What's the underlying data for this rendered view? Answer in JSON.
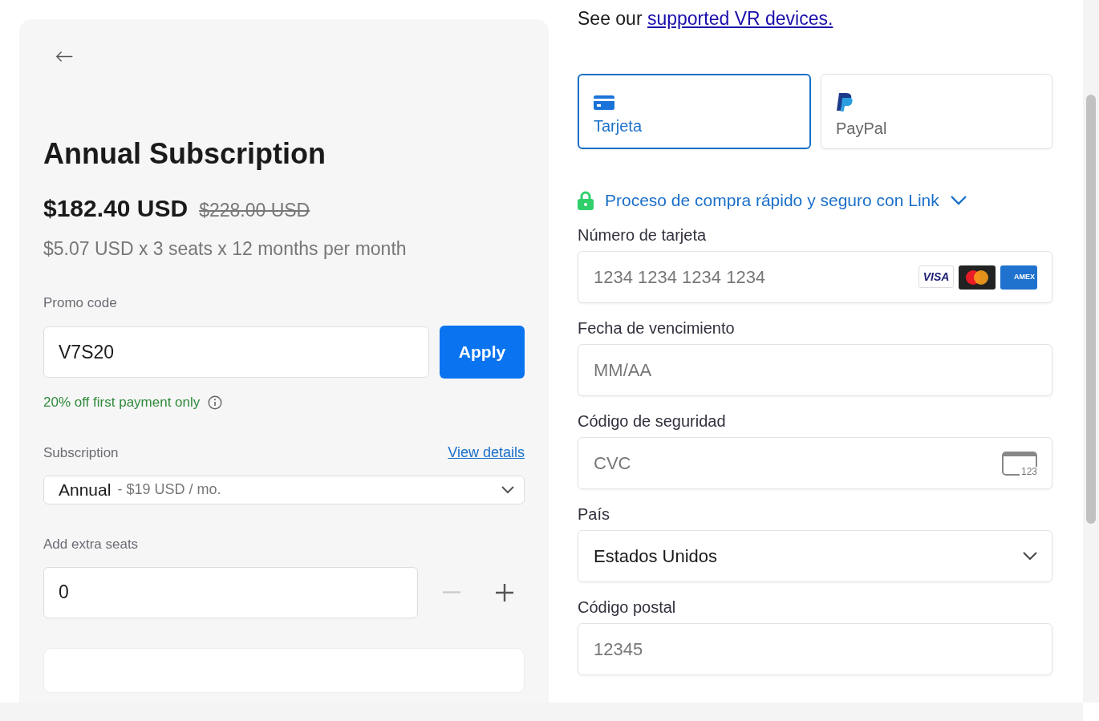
{
  "intro": {
    "text": "See our",
    "link": "supported VR devices."
  },
  "order": {
    "title": "Annual Subscription",
    "price": "$182.40 USD",
    "original_price": "$228.00 USD",
    "breakdown": "$5.07 USD x 3 seats x 12 months per month"
  },
  "promo": {
    "label": "Promo code",
    "value": "V7S20",
    "button": "Apply",
    "note": "20% off first payment only"
  },
  "subscription": {
    "label": "Subscription",
    "link": "View details",
    "plan": "Annual",
    "plan_price": "- $19 USD / mo."
  },
  "seats": {
    "label": "Add extra seats",
    "value": "0",
    "decrement_disabled": true
  },
  "payment_methods": [
    {
      "label": "Tarjeta",
      "kind": "card",
      "selected": true
    },
    {
      "label": "PayPal",
      "kind": "paypal",
      "selected": false
    }
  ],
  "link_banner": "Proceso de compra rápido y seguro con Link",
  "fields": [
    {
      "label": "Número de tarjeta",
      "kind": "card",
      "placeholder": "1234 1234 1234 1234",
      "brands": [
        {
          "kind": "visa",
          "label": "VISA"
        },
        {
          "kind": "mastercard"
        },
        {
          "kind": "amex",
          "label": "AMEX"
        }
      ]
    },
    {
      "label": "Fecha de vencimiento",
      "kind": "text",
      "placeholder": "MM/AA"
    },
    {
      "label": "Código de seguridad",
      "kind": "cvc",
      "placeholder": "CVC",
      "icon_text": "123"
    },
    {
      "label": "País",
      "kind": "select",
      "value": "Estados Unidos"
    },
    {
      "label": "Código postal",
      "kind": "text",
      "placeholder": "12345"
    }
  ]
}
